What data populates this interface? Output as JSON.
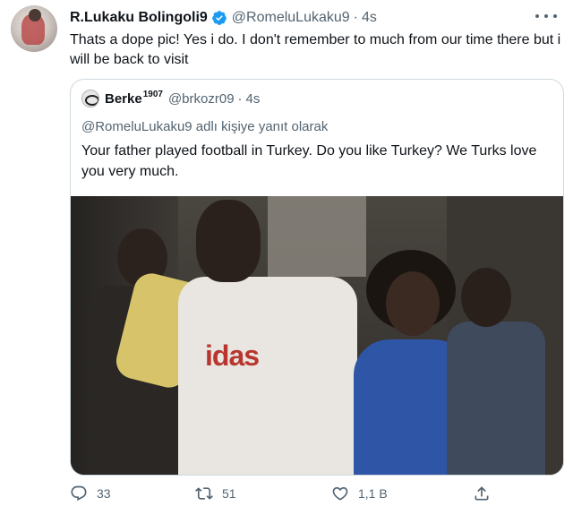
{
  "tweet": {
    "display_name": "R.Lukaku Bolingoli9",
    "handle": "@RomeluLukaku9",
    "separator": "·",
    "time": "4s",
    "text": "Thats a dope pic! Yes i do. I don't remember to much from our time there but i will be back to visit",
    "verified_icon": "verified-badge-icon",
    "more_icon": "more-options-icon"
  },
  "quoted": {
    "display_name": "Berke",
    "display_name_sup": "1907",
    "handle": "@brkozr09",
    "separator": "·",
    "time": "4s",
    "reply_context": "@RomeluLukaku9 adlı kişiye yanıt olarak",
    "text": "Your father played football in Turkey. Do you like Turkey? We Turks love you very much.",
    "photo_text": "idas"
  },
  "actions": {
    "reply_count": "33",
    "retweet_count": "51",
    "like_count": "1,1 B"
  },
  "colors": {
    "text_primary": "#0f1419",
    "text_secondary": "#536471",
    "border": "#cfd9de",
    "verified": "#1d9bf0"
  }
}
